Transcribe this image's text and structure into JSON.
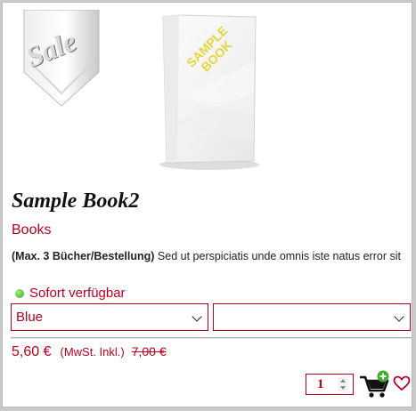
{
  "product": {
    "sale_badge": "Sale",
    "image_label_line1": "SAMPLE",
    "image_label_line2": "BOOK",
    "title": "Sample Book2",
    "category": "Books",
    "description_bold": "(Max. 3 Bücher/Bestellung)",
    "description_text": " Sed ut perspiciatis unde omnis iste natus error sit",
    "availability": "Sofort verfügbar",
    "variant_option_1": "Blue",
    "variant_option_2": "",
    "price": "5,60 €",
    "tax_note": "(MwSt. Inkl.)",
    "old_price": "7,00 €",
    "quantity": "1"
  },
  "icons": {
    "cart": "add-to-cart-icon",
    "wishlist": "heart-icon",
    "availability": "green-dot-icon"
  },
  "colors": {
    "accent": "#b8001e",
    "ribbon_text": "#e5d63b",
    "availability_dot": "#2ea81f"
  }
}
